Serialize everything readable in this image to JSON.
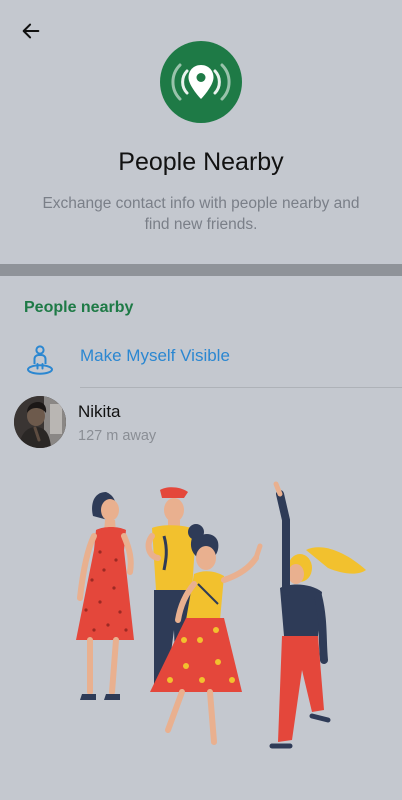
{
  "colors": {
    "background": "#c4c8cf",
    "accent_green": "#1e7a46",
    "link_blue": "#2b87d1"
  },
  "header": {
    "back_icon": "arrow-left-icon",
    "hero_icon": "location-pin-broadcast-icon",
    "title": "People Nearby",
    "subtitle": "Exchange contact info with people nearby and find new friends."
  },
  "section": {
    "header": "People nearby",
    "make_visible_icon": "person-on-location-icon",
    "make_visible_label": "Make Myself Visible"
  },
  "people": [
    {
      "name": "Nikita",
      "distance": "127 m away",
      "avatar_icon": "user-photo-avatar"
    }
  ],
  "illustration": {
    "icon": "people-dancing-illustration"
  }
}
